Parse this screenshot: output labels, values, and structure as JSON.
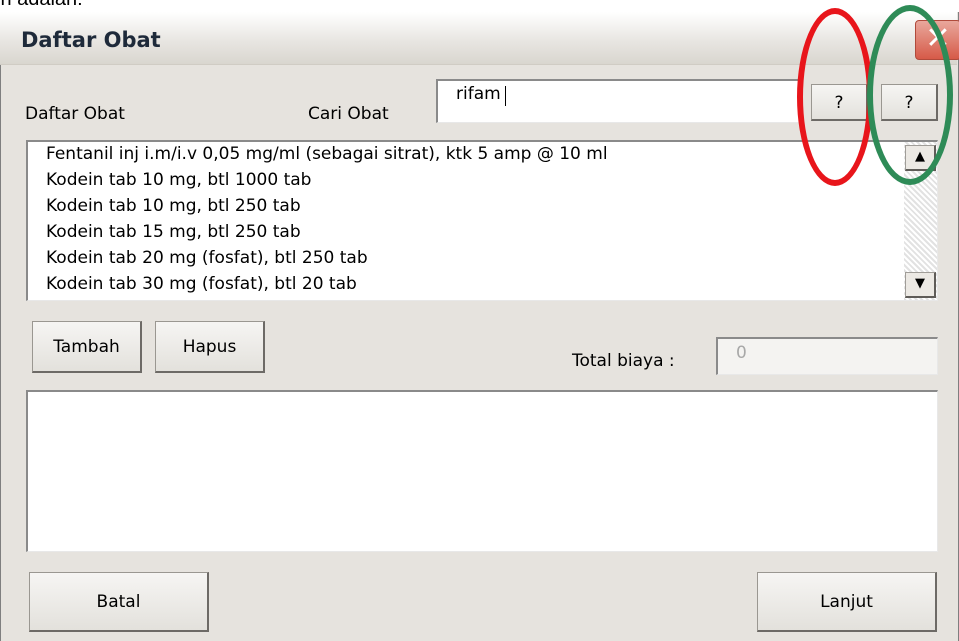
{
  "top_caption": "in adalah:",
  "window": {
    "title": "Daftar Obat",
    "close_glyph": "✕"
  },
  "labels": {
    "list_label": "Daftar Obat",
    "search_label": "Cari Obat",
    "total_label": "Total biaya :"
  },
  "search": {
    "value": "rifam"
  },
  "help_buttons": [
    {
      "label": "?"
    },
    {
      "label": "?"
    }
  ],
  "drug_list": [
    "Fentanil inj i.m/i.v 0,05 mg/ml (sebagai sitrat), ktk 5 amp @ 10 ml",
    "Kodein tab 10 mg, btl 1000 tab",
    "Kodein tab 10 mg, btl 250 tab",
    "Kodein tab 15 mg, btl 250 tab",
    "Kodein tab 20 mg (fosfat), btl 250 tab",
    "Kodein tab 30 mg (fosfat), btl 20 tab"
  ],
  "scrollbar": {
    "up_glyph": "▲",
    "down_glyph": "▼"
  },
  "buttons": {
    "add": "Tambah",
    "remove": "Hapus",
    "cancel": "Batal",
    "next": "Lanjut"
  },
  "total": {
    "value": "0"
  },
  "annotation_colors": {
    "red_ring": "#e8151b",
    "green_ring": "#2e8b57"
  },
  "icons": [
    "close-icon",
    "scroll-up-icon",
    "scroll-down-icon"
  ]
}
